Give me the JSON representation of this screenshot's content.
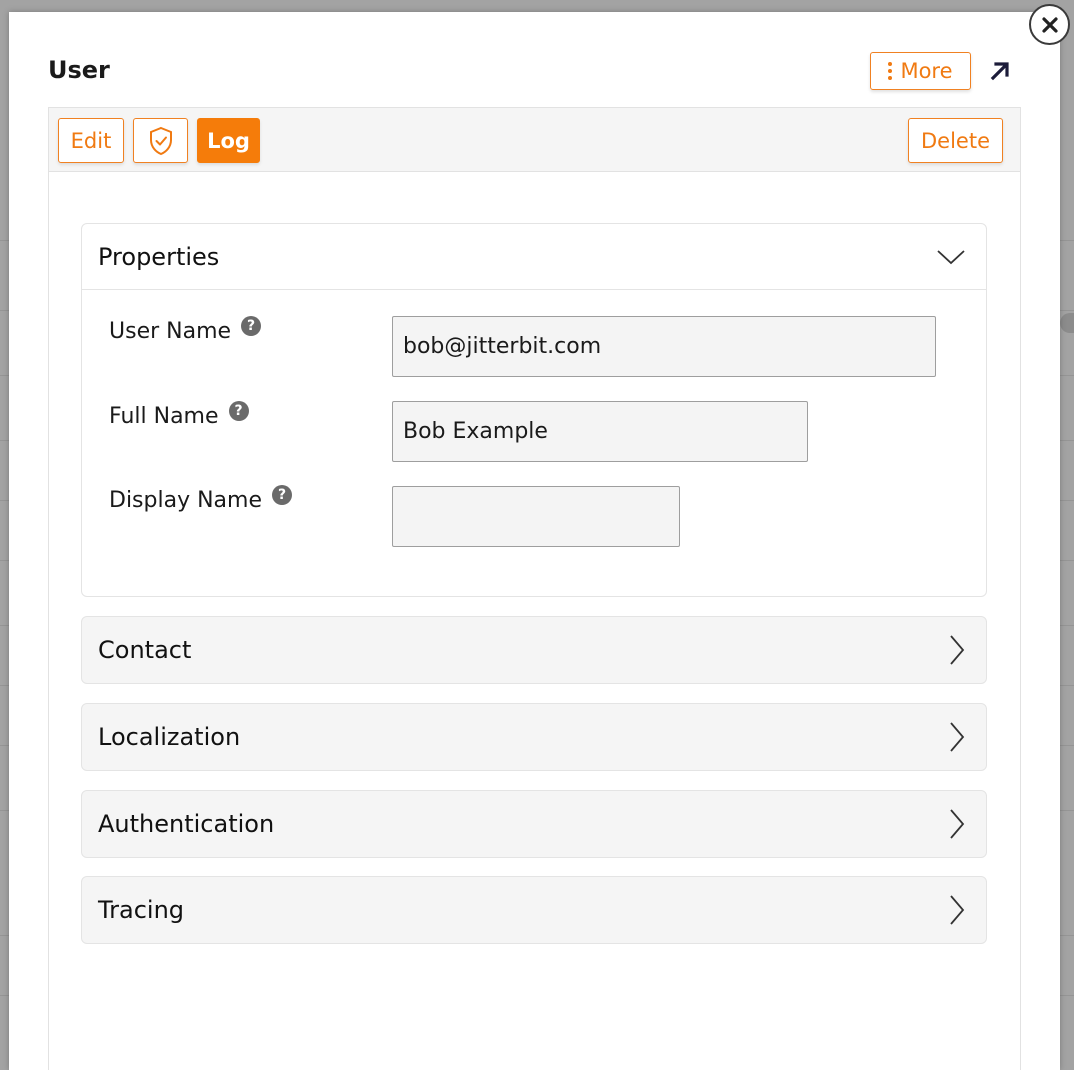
{
  "modal": {
    "title": "User",
    "more_label": "More",
    "accent_color": "#f57c0a"
  },
  "toolbar": {
    "edit_label": "Edit",
    "log_label": "Log",
    "delete_label": "Delete"
  },
  "properties": {
    "title": "Properties",
    "fields": [
      {
        "label": "User Name",
        "value": "bob@jitterbit.com"
      },
      {
        "label": "Full Name",
        "value": "Bob Example"
      },
      {
        "label": "Display Name",
        "value": ""
      }
    ]
  },
  "sections": [
    {
      "title": "Contact"
    },
    {
      "title": "Localization"
    },
    {
      "title": "Authentication"
    },
    {
      "title": "Tracing"
    }
  ],
  "icons": [
    "close-icon",
    "more-vertical-icon",
    "expand-arrow-icon",
    "shield-check-icon",
    "chevron-down-icon",
    "chevron-right-icon",
    "help-icon"
  ]
}
